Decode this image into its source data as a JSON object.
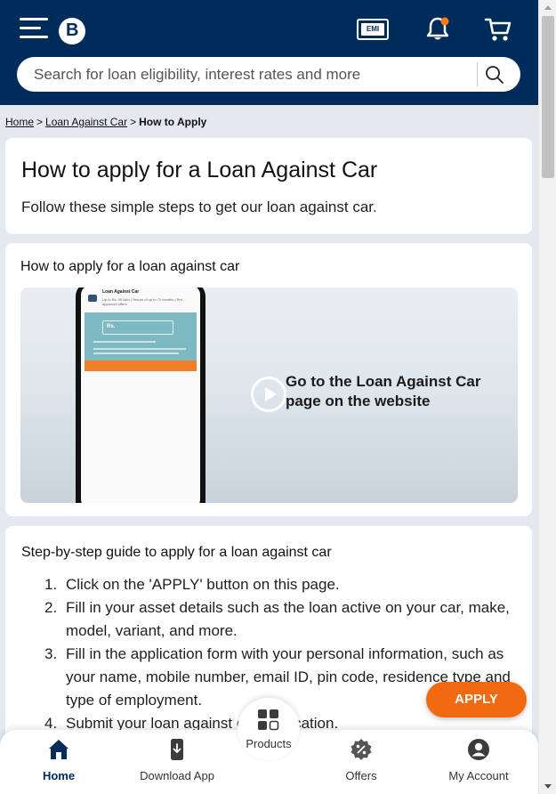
{
  "header": {
    "logo_letter": "B",
    "emi_label": "EMI",
    "search": {
      "placeholder": "Search for loan eligibility, interest rates and more"
    },
    "notification_dot_color": "#ff7a1a",
    "background_color": "#002c5c"
  },
  "breadcrumb": {
    "items": [
      "Home",
      "Loan Against Car"
    ],
    "separator": ">",
    "current": "How to Apply"
  },
  "intro": {
    "title": "How to apply for a Loan Against Car",
    "subtitle": "Follow these simple steps to get our loan against car."
  },
  "video_section": {
    "title": "How to apply for a loan against car",
    "caption": "Go to the Loan Against Car page on the website",
    "phone_screen": {
      "title": "Loan Against Car",
      "subtitle": "Up to Rs. 30 lakh | Tenure of up to 72 months | Pre-approved offers",
      "input_prefix": "Rs."
    }
  },
  "guide": {
    "title": "Step-by-step guide to apply for a loan against car",
    "steps": [
      {
        "num": "1.",
        "text": "Click on the 'APPLY' button on this page."
      },
      {
        "num": "2.",
        "text": "Fill in your asset details such as the loan active on your car, make, model, variant, and more."
      },
      {
        "num": "3.",
        "text": "Fill in the application form with your personal information, such as your name, mobile number, email ID, pin code, residence type and type of employment."
      },
      {
        "num": "4.",
        "text": "Submit your loan against car application."
      }
    ]
  },
  "apply_button": {
    "label": "APPLY",
    "color": "#f26a10"
  },
  "bottom_nav": {
    "home": "Home",
    "download": "Download App",
    "products": "Products",
    "offers": "Offers",
    "account": "My Account"
  }
}
